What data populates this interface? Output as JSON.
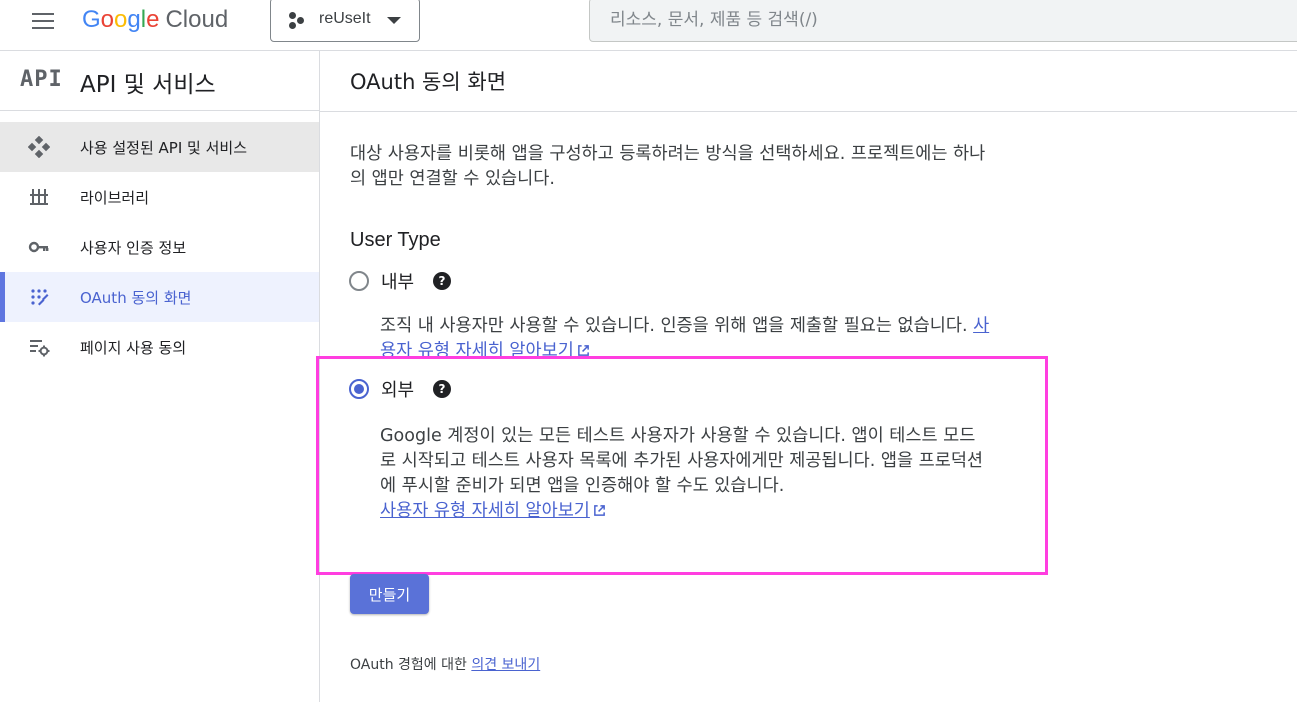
{
  "header": {
    "logo_letters": [
      "G",
      "o",
      "o",
      "g",
      "l",
      "e"
    ],
    "logo_suffix": "Cloud",
    "project_name": "reUseIt",
    "search_placeholder": "리소스, 문서, 제품 등 검색(/)"
  },
  "sidebar": {
    "icon_text": "API",
    "title": "API 및 서비스",
    "items": [
      {
        "label": "사용 설정된 API 및 서비스",
        "icon": "dashboard-icon",
        "state": "selected"
      },
      {
        "label": "라이브러리",
        "icon": "library-icon",
        "state": "normal"
      },
      {
        "label": "사용자 인증 정보",
        "icon": "key-icon",
        "state": "normal"
      },
      {
        "label": "OAuth 동의 화면",
        "icon": "oauth-consent-icon",
        "state": "active"
      },
      {
        "label": "페이지 사용 동의",
        "icon": "settings-list-icon",
        "state": "normal"
      }
    ]
  },
  "main": {
    "title": "OAuth 동의 화면",
    "description": "대상 사용자를 비롯해 앱을 구성하고 등록하려는 방식을 선택하세요. 프로젝트에는 하나의 앱만 연결할 수 있습니다.",
    "user_type_title": "User Type",
    "options": [
      {
        "label": "내부",
        "checked": false,
        "description": "조직 내 사용자만 사용할 수 있습니다. 인증을 위해 앱을 제출할 필요는 없습니다.",
        "link": "사용자 유형 자세히 알아보기"
      },
      {
        "label": "외부",
        "checked": true,
        "description": "Google 계정이 있는 모든 테스트 사용자가 사용할 수 있습니다. 앱이 테스트 모드로 시작되고 테스트 사용자 목록에 추가된 사용자에게만 제공됩니다. 앱을 프로덕션에 푸시할 준비가 되면 앱을 인증해야 할 수도 있습니다.",
        "link": "사용자 유형 자세히 알아보기"
      }
    ],
    "create_button": "만들기",
    "feedback_prefix": "OAuth 경험에 대한",
    "feedback_link": "의견 보내기"
  },
  "colors": {
    "accent": "#4a63d0",
    "button": "#5a72d8",
    "highlight": "#ff3ee0"
  }
}
